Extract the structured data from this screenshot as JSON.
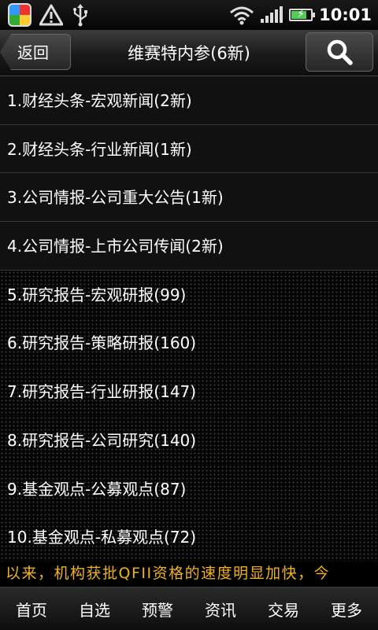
{
  "status_bar": {
    "time": "10:01",
    "icons": [
      "app-launcher-icon",
      "warning-icon",
      "usb-icon",
      "wifi-icon",
      "signal-icon",
      "battery-charging-icon"
    ],
    "battery_level": 0.8
  },
  "header": {
    "back_label": "返回",
    "title": "维赛特内参(6新)",
    "search_icon": "search-icon"
  },
  "list": {
    "items": [
      {
        "label": "1.财经头条-宏观新闻(2新)"
      },
      {
        "label": "2.财经头条-行业新闻(1新)"
      },
      {
        "label": "3.公司情报-公司重大公告(1新)"
      },
      {
        "label": "4.公司情报-上市公司传闻(2新)"
      },
      {
        "label": "5.研究报告-宏观研报(99)"
      },
      {
        "label": "6.研究报告-策略研报(160)"
      },
      {
        "label": "7.研究报告-行业研报(147)"
      },
      {
        "label": "8.研究报告-公司研究(140)"
      },
      {
        "label": "9.基金观点-公募观点(87)"
      },
      {
        "label": "10.基金观点-私募观点(72)"
      }
    ]
  },
  "ticker": {
    "text": "以来，机构获批QFII资格的速度明显加快，今"
  },
  "tabbar": {
    "tabs": [
      "首页",
      "自选",
      "预警",
      "资讯",
      "交易",
      "更多"
    ]
  },
  "colors": {
    "ticker_text": "#f2b31a",
    "background": "#000000"
  }
}
